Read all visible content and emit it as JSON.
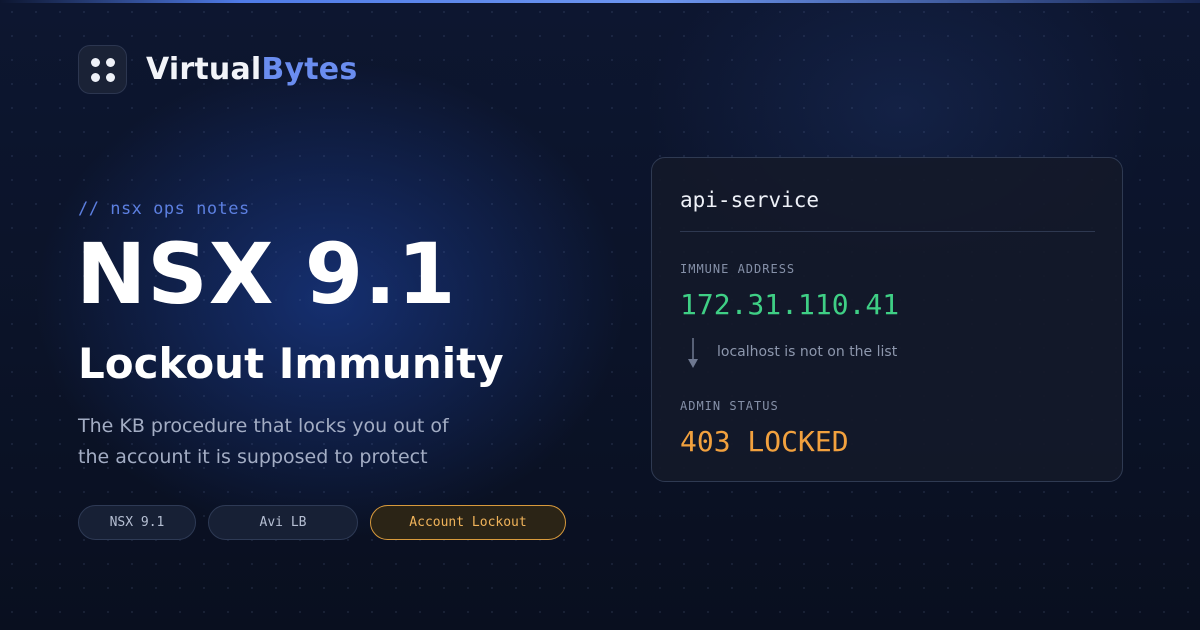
{
  "brand": {
    "name_part1": "Virtual",
    "name_part2": "Bytes",
    "logo_icon": "four-dots-icon"
  },
  "hero": {
    "kicker": "// nsx ops notes",
    "title": "NSX 9.1",
    "subtitle": "Lockout Immunity",
    "description_line1": "The KB procedure that locks you out of",
    "description_line2": "the account it is supposed to protect"
  },
  "tags": [
    {
      "label": "NSX 9.1"
    },
    {
      "label": "Avi LB"
    },
    {
      "label": "Account Lockout",
      "accent": "#f0b35a"
    }
  ],
  "card": {
    "title": "api-service",
    "immune_label": "IMMUNE ADDRESS",
    "immune_value": "172.31.110.41",
    "note_icon": "arrow-down-icon",
    "note": "localhost is not on the list",
    "admin_label": "ADMIN STATUS",
    "admin_value": "403 LOCKED"
  },
  "colors": {
    "background": "#0b1328",
    "brand_accent": "#6a8df0",
    "kicker": "#5c7fe0",
    "immune_green": "#3fcf85",
    "locked_orange": "#f2a13e",
    "tag_accent_border": "#d89a3c"
  }
}
